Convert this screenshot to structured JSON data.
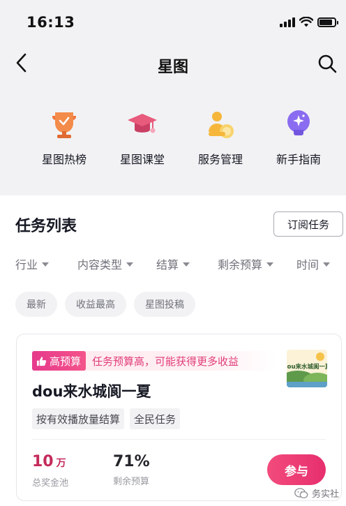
{
  "status_bar": {
    "time": "16:13"
  },
  "nav": {
    "title": "星图"
  },
  "quick_links": [
    {
      "label": "星图热榜",
      "icon": "trophy-icon"
    },
    {
      "label": "星图课堂",
      "icon": "graduation-cap-icon"
    },
    {
      "label": "服务管理",
      "icon": "service-people-icon"
    },
    {
      "label": "新手指南",
      "icon": "lightbulb-icon"
    }
  ],
  "task_section": {
    "title": "任务列表",
    "subscribe_label": "订阅任务",
    "filters": [
      "行业",
      "内容类型",
      "结算",
      "剩余预算",
      "时间"
    ],
    "sort_chips": [
      "最新",
      "收益最高",
      "星图投稿"
    ]
  },
  "task_card": {
    "promo_badge": "高预算",
    "promo_text": "任务预算高，可能获得更多收益",
    "title": "dou来水城阆一夏",
    "thumbnail_text": "dou来水城阆一夏",
    "tags": [
      "按有效播放量结算",
      "全民任务"
    ],
    "prize_pool_value": "10",
    "prize_pool_unit": "万",
    "prize_pool_label": "总奖金池",
    "remaining_budget_value": "71%",
    "remaining_budget_label": "剩余预算",
    "join_label": "参与"
  },
  "watermark": {
    "text": "务实社"
  },
  "colors": {
    "accent": "#e72f6e",
    "promo_text": "#e13c79",
    "prize_value": "#c42a5a",
    "top_background": "#f2f2f4"
  }
}
